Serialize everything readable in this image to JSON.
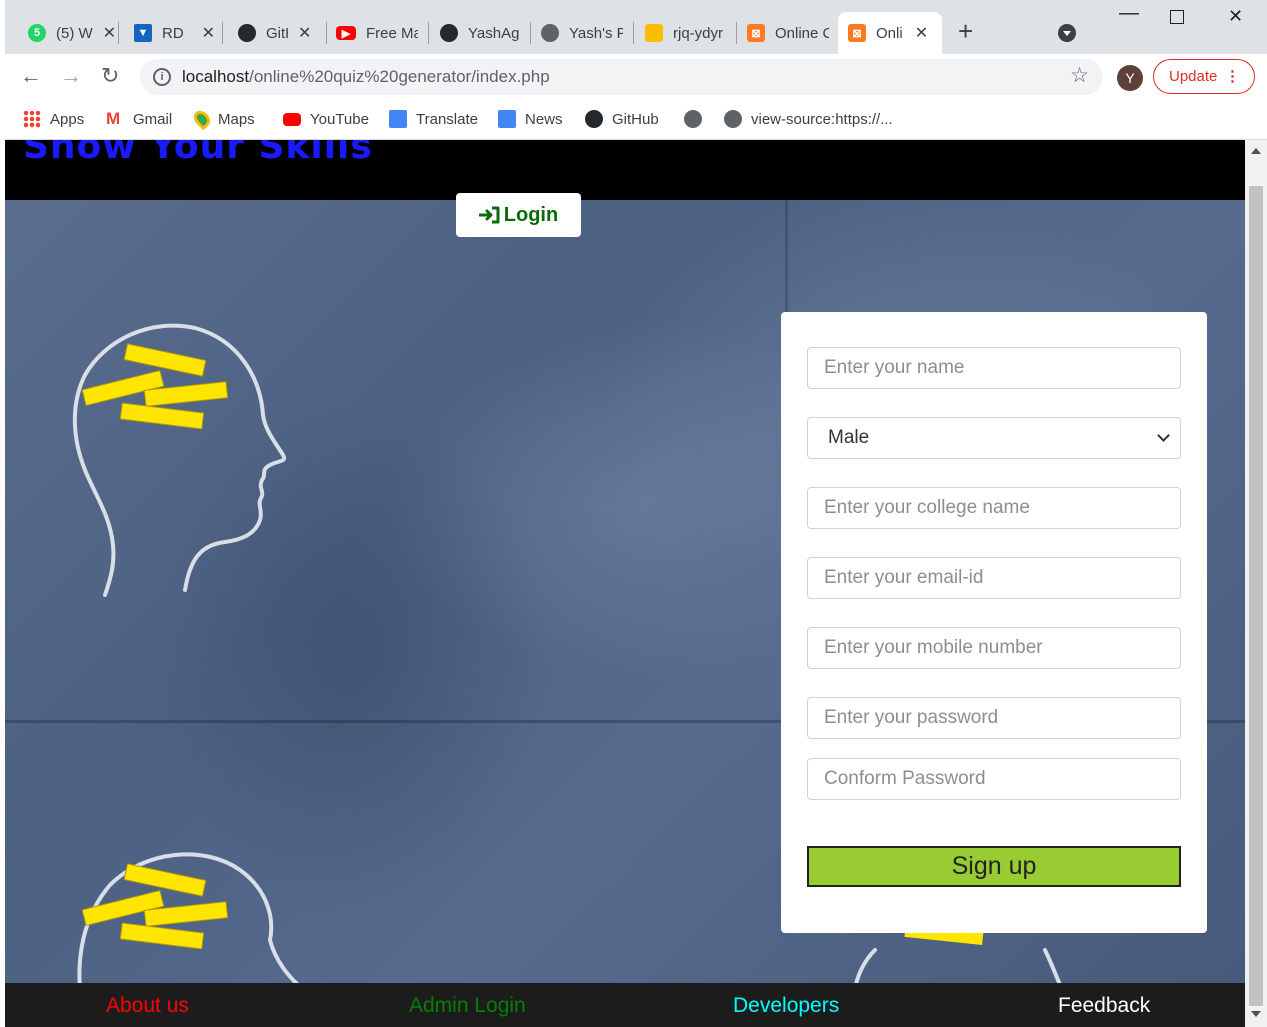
{
  "browser": {
    "tabs": [
      {
        "title": "(5) W",
        "icon": "whatsapp-icon",
        "color": "#25d366"
      },
      {
        "title": "RD",
        "icon": "rd-icon",
        "color": "#1565c0"
      },
      {
        "title": "GitHub",
        "icon": "github-icon",
        "color": "#24292e"
      },
      {
        "title": "Free Ma",
        "icon": "youtube-icon",
        "color": "#ff0000"
      },
      {
        "title": "YashAg",
        "icon": "github-icon",
        "color": "#24292e"
      },
      {
        "title": "Yash's P",
        "icon": "globe-icon",
        "color": "#5f6368"
      },
      {
        "title": "rjq-ydyr",
        "icon": "thumb-icon",
        "color": "#fbbc04"
      },
      {
        "title": "Online C",
        "icon": "xampp-icon",
        "color": "#fb7a24"
      },
      {
        "title": "Onli",
        "icon": "xampp-icon",
        "color": "#fb7a24"
      }
    ],
    "url_host": "localhost",
    "url_path": "/online%20quiz%20generator/index.php",
    "profile_initial": "Y",
    "update_label": "Update",
    "bookmarks": [
      {
        "label": "Apps",
        "icon": "apps-grid-icon"
      },
      {
        "label": "Gmail",
        "icon": "gmail-icon"
      },
      {
        "label": "Maps",
        "icon": "maps-pin-icon"
      },
      {
        "label": "YouTube",
        "icon": "youtube-icon"
      },
      {
        "label": "Translate",
        "icon": "translate-icon"
      },
      {
        "label": "News",
        "icon": "news-icon"
      },
      {
        "label": "GitHub",
        "icon": "github-icon"
      },
      {
        "label": "",
        "icon": "globe-icon"
      },
      {
        "label": "view-source:https://...",
        "icon": "globe-icon"
      }
    ]
  },
  "site": {
    "brand": "Show Your Skills",
    "login_label": "Login",
    "form": {
      "name_placeholder": "Enter your name",
      "gender_selected": "Male",
      "college_placeholder": "Enter your college name",
      "email_placeholder": "Enter your email-id",
      "mobile_placeholder": "Enter your mobile number",
      "password_placeholder": "Enter your password",
      "confirm_placeholder": "Conform Password",
      "signup_label": "Sign up"
    },
    "footer": [
      {
        "label": "About us",
        "color": "#ff0000"
      },
      {
        "label": "Admin Login",
        "color": "#008000"
      },
      {
        "label": "Developers",
        "color": "#00ffff"
      },
      {
        "label": "Feedback",
        "color": "#ffffff"
      }
    ]
  },
  "colors": {
    "brand": "#1a1aff",
    "login_text": "#0a6b0a",
    "signup_bg": "#99cc33",
    "header_bg": "#000000",
    "footer_bg": "#1c1c1c"
  }
}
